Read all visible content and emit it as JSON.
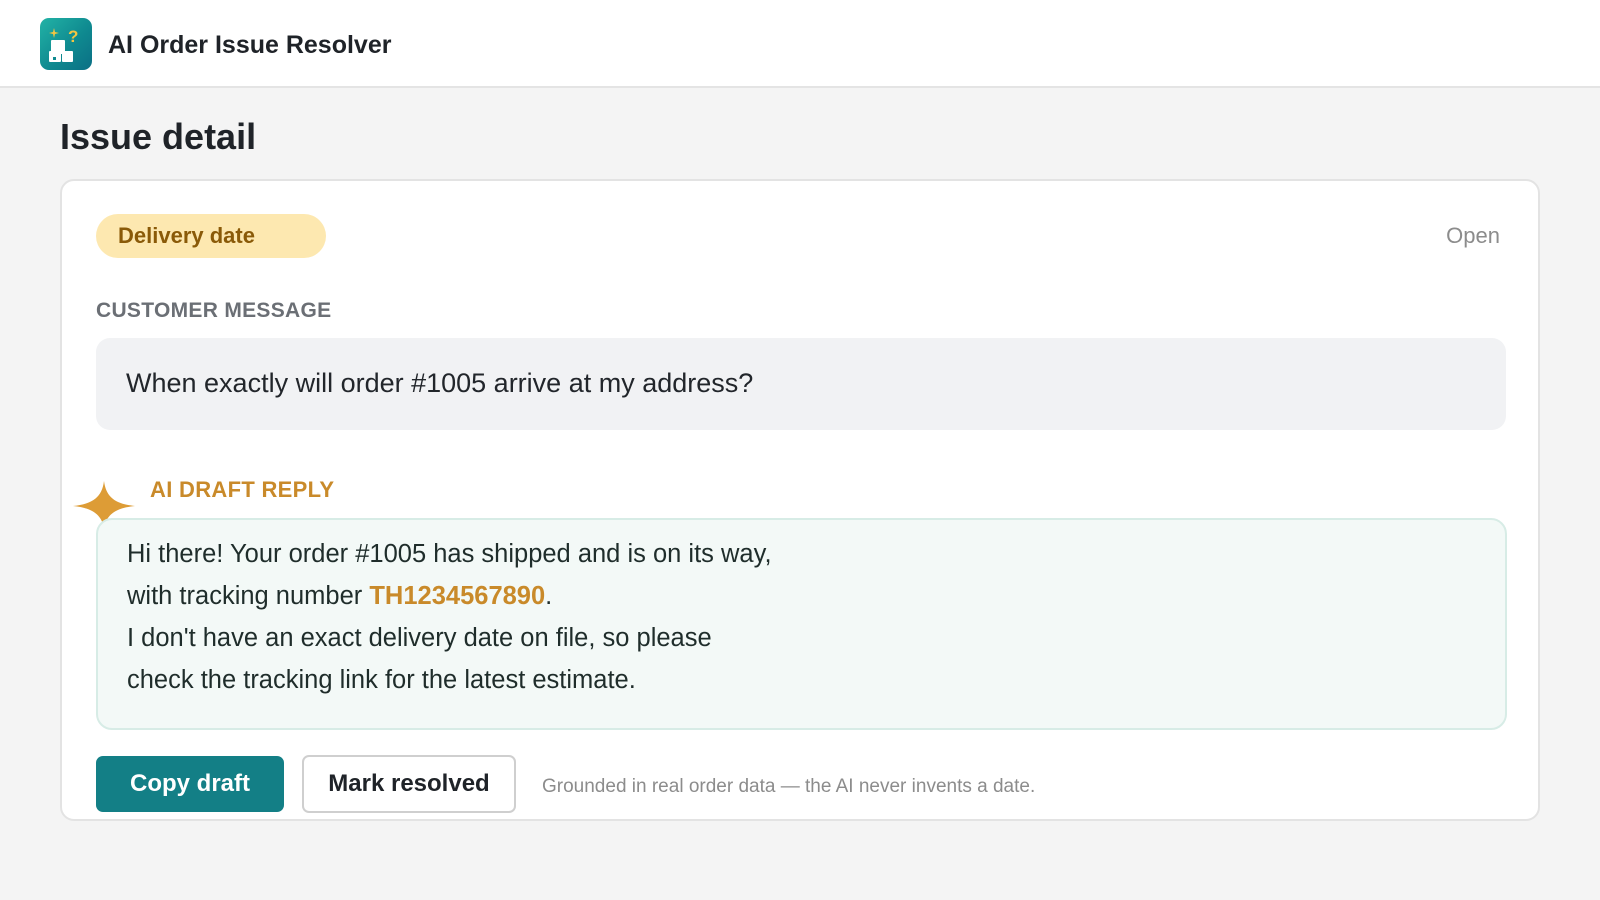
{
  "app": {
    "title": "AI Order Issue Resolver",
    "logo_icon": "app-logo-icon",
    "logo_glyph": "?"
  },
  "page": {
    "title": "Issue detail"
  },
  "issue": {
    "category_badge": "Delivery date",
    "status": "Open",
    "customer_message_label": "CUSTOMER MESSAGE",
    "customer_message": "When exactly will order #1005 arrive at my address?",
    "ai_draft_label": "AI DRAFT REPLY",
    "ai_draft": {
      "line1": "Hi there! Your order #1005 has shipped and is on its way,",
      "line2_prefix": "with tracking number ",
      "tracking_number": "TH1234567890",
      "line2_suffix": ".",
      "line3": "I don't have an exact delivery date on file, so please",
      "line4": "check the tracking link for the latest estimate."
    }
  },
  "actions": {
    "copy_label": "Copy draft",
    "resolve_label": "Mark resolved",
    "footnote": "Grounded in real order data — the AI never invents a date."
  },
  "colors": {
    "accent_teal": "#137f86",
    "accent_gold": "#c98a2a",
    "badge_bg": "#fde8b0",
    "badge_text": "#8a5a08",
    "page_bg": "#f4f4f4"
  },
  "icons": {
    "sparkle": "sparkle-icon"
  }
}
